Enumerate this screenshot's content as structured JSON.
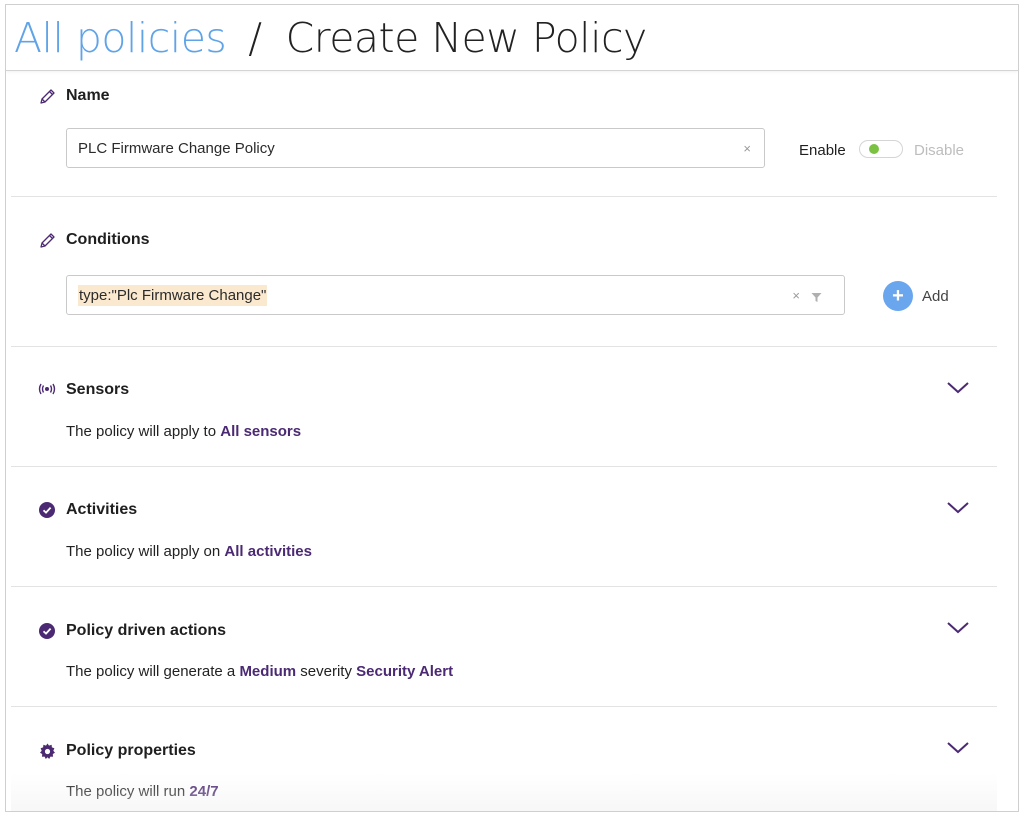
{
  "breadcrumb": {
    "link": "All policies",
    "separator": "/",
    "current": "Create New Policy"
  },
  "name_section": {
    "title": "Name",
    "icon": "pencil-icon",
    "input_value": "PLC Firmware Change Policy",
    "clear": "×",
    "enable_label": "Enable",
    "disable_label": "Disable",
    "enabled": true
  },
  "conditions": {
    "title": "Conditions",
    "icon": "pencil-icon",
    "value": "type:\"Plc Firmware Change\"",
    "clear": "×",
    "add_label": "Add",
    "add_symbol": "+"
  },
  "sensors": {
    "title": "Sensors",
    "icon": "broadcast-icon",
    "text_prefix": "The policy will apply to ",
    "text_value": "All sensors"
  },
  "activities": {
    "title": "Activities",
    "icon": "check-circle-icon",
    "text_prefix": "The policy will apply on ",
    "text_value": "All activities"
  },
  "actions": {
    "title": "Policy driven actions",
    "icon": "check-circle-icon",
    "text_prefix": "The policy will generate a ",
    "severity": "Medium",
    "text_middle": " severity ",
    "alert_type": "Security Alert"
  },
  "properties": {
    "title": "Policy properties",
    "icon": "gear-icon",
    "text_prefix": "The policy will run ",
    "text_value": "24/7"
  },
  "colors": {
    "link_blue": "#5fa3e8",
    "accent_purple": "#4b2a73",
    "toggle_green": "#7cc242",
    "add_blue": "#6aa6ee",
    "chip_bg": "#fbe9cf"
  }
}
